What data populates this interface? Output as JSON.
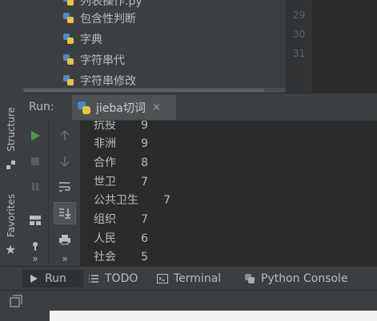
{
  "sidebar": {
    "structure_label": "Structure",
    "favorites_label": "Favorites"
  },
  "project_tree": {
    "items": [
      {
        "label": "列表操作.py"
      },
      {
        "label": "包含性判断"
      },
      {
        "label": "字典"
      },
      {
        "label": "字符串代"
      },
      {
        "label": "字符串修改"
      }
    ]
  },
  "editor": {
    "line_numbers": [
      "29",
      "30",
      "31"
    ]
  },
  "run_panel": {
    "title": "Run:",
    "tab_label": "jieba切词",
    "close_glyph": "×"
  },
  "console": {
    "lines": [
      "抗投       9",
      "非洲       9",
      "合作       8",
      "世卫       7",
      "公共卫生       7",
      "组织       7",
      "人民       6",
      "社会       5"
    ]
  },
  "bottom_bar": {
    "run_label": "Run",
    "todo_label": "TODO",
    "terminal_label": "Terminal",
    "python_console_label": "Python Console"
  },
  "colors": {
    "background": "#3c3f41",
    "console_bg": "#2b2b2b",
    "run_green": "#499c54",
    "text": "#bbbbbb"
  }
}
